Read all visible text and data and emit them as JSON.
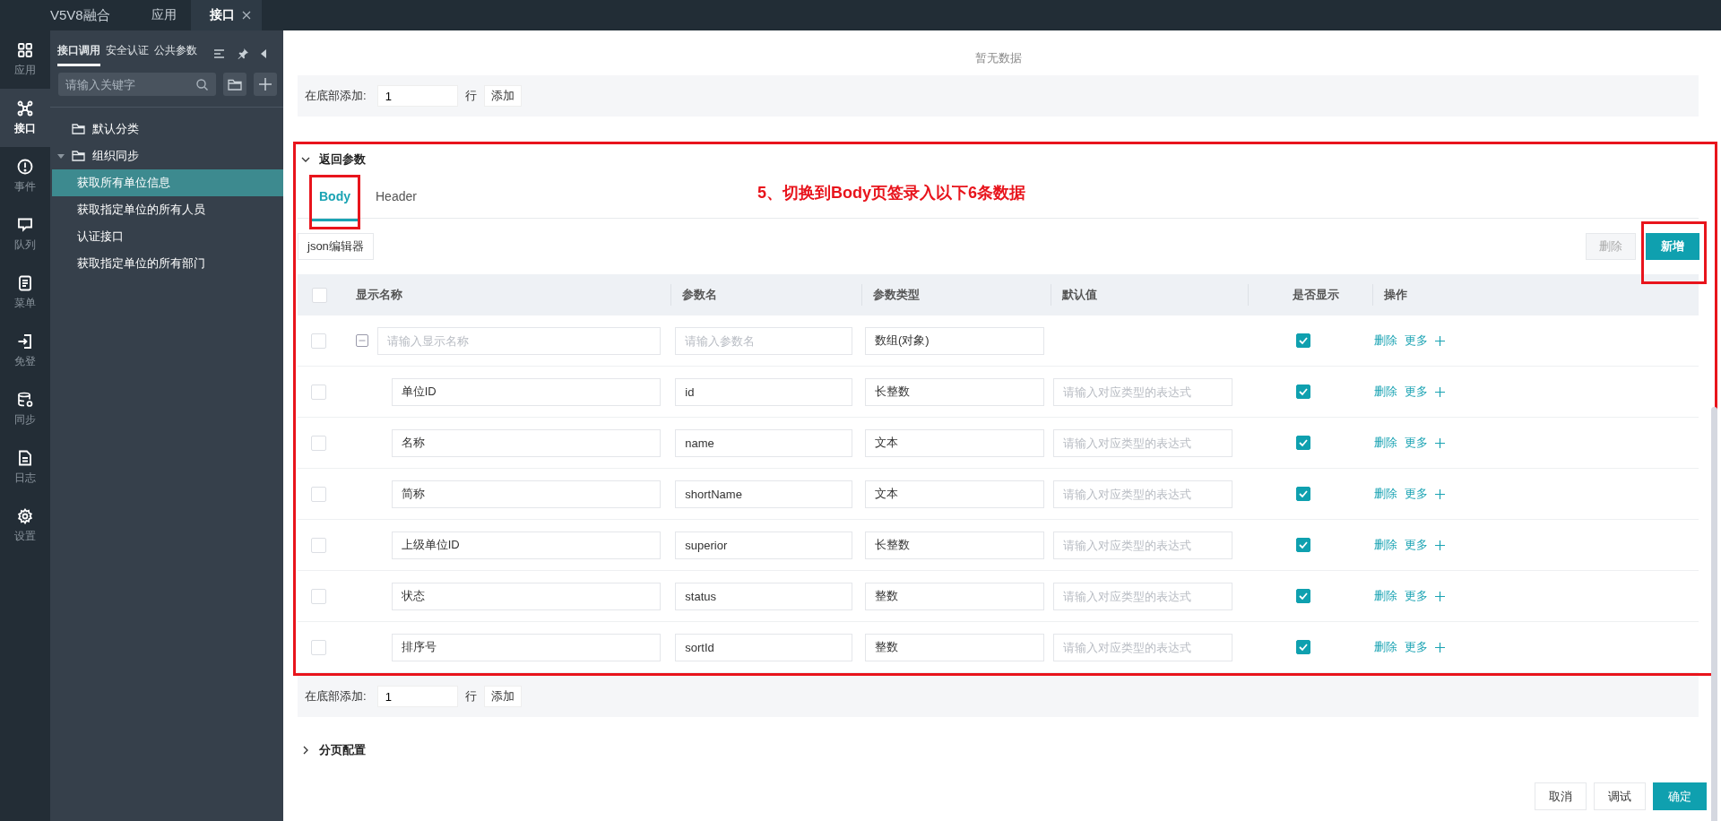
{
  "topbar": {
    "app_title": "V5V8融合",
    "tabs": [
      {
        "label": "应用",
        "selected": false,
        "closable": false
      },
      {
        "label": "接口",
        "selected": true,
        "closable": true
      }
    ]
  },
  "rail": [
    {
      "label": "应用",
      "kind": "grid",
      "selected": false
    },
    {
      "label": "接口",
      "kind": "nodes",
      "selected": true
    },
    {
      "label": "事件",
      "kind": "alert",
      "selected": false
    },
    {
      "label": "队列",
      "kind": "chat",
      "selected": false
    },
    {
      "label": "菜单",
      "kind": "note",
      "selected": false
    },
    {
      "label": "免登",
      "kind": "login",
      "selected": false
    },
    {
      "label": "同步",
      "kind": "database",
      "selected": false
    },
    {
      "label": "日志",
      "kind": "file",
      "selected": false
    },
    {
      "label": "设置",
      "kind": "gear",
      "selected": false
    }
  ],
  "sidebar": {
    "tabs": [
      {
        "label": "接口调用",
        "selected": true
      },
      {
        "label": "安全认证",
        "selected": false
      },
      {
        "label": "公共参数",
        "selected": false
      }
    ],
    "search": {
      "placeholder": "请输入关键字"
    },
    "tree": [
      {
        "label": "默认分类",
        "expanded": false
      },
      {
        "label": "组织同步",
        "expanded": true,
        "children": [
          {
            "label": "获取所有单位信息",
            "selected": true
          },
          {
            "label": "获取指定单位的所有人员",
            "selected": false
          },
          {
            "label": "认证接口",
            "selected": false
          },
          {
            "label": "获取指定单位的所有部门",
            "selected": false
          }
        ]
      }
    ]
  },
  "main": {
    "empty_text": "暂无数据",
    "top_add_bar": {
      "label": "在底部添加:",
      "value": "1",
      "unit": "行",
      "button": "添加"
    },
    "section": {
      "title": "返回参数",
      "expanded": true,
      "highlighted": true,
      "annotation": "5、切换到Body页签录入以下6条数据",
      "tabs": [
        {
          "label": "Body",
          "selected": true,
          "highlighted": true
        },
        {
          "label": "Header",
          "selected": false,
          "highlighted": false
        }
      ],
      "json_button": "json编辑器",
      "delete_button": {
        "label": "删除",
        "disabled": true
      },
      "add_button": {
        "label": "新增",
        "highlighted": true
      },
      "table": {
        "columns": [
          "显示名称",
          "参数名",
          "参数类型",
          "默认值",
          "是否显示",
          "操作"
        ],
        "rows": [
          {
            "name_placeholder": "请输入显示名称",
            "param_placeholder": "请输入参数名",
            "type": "数组(对象)",
            "visible": true,
            "actions": [
              "删除",
              "更多"
            ],
            "expanded": true,
            "children": [
              {
                "name": "单位ID",
                "param": "id",
                "type": "长整数",
                "default_placeholder": "请输入对应类型的表达式",
                "visible": true,
                "actions": [
                  "删除",
                  "更多"
                ]
              },
              {
                "name": "名称",
                "param": "name",
                "type": "文本",
                "default_placeholder": "请输入对应类型的表达式",
                "visible": true,
                "actions": [
                  "删除",
                  "更多"
                ]
              },
              {
                "name": "简称",
                "param": "shortName",
                "type": "文本",
                "default_placeholder": "请输入对应类型的表达式",
                "visible": true,
                "actions": [
                  "删除",
                  "更多"
                ]
              },
              {
                "name": "上级单位ID",
                "param": "superior",
                "type": "长整数",
                "default_placeholder": "请输入对应类型的表达式",
                "visible": true,
                "actions": [
                  "删除",
                  "更多"
                ]
              },
              {
                "name": "状态",
                "param": "status",
                "type": "整数",
                "default_placeholder": "请输入对应类型的表达式",
                "visible": true,
                "actions": [
                  "删除",
                  "更多"
                ]
              },
              {
                "name": "排序号",
                "param": "sortId",
                "type": "整数",
                "default_placeholder": "请输入对应类型的表达式",
                "visible": true,
                "actions": [
                  "删除",
                  "更多"
                ]
              }
            ]
          }
        ]
      }
    },
    "bottom_add_bar": {
      "label": "在底部添加:",
      "value": "1",
      "unit": "行",
      "button": "添加"
    },
    "paging_section": {
      "title": "分页配置",
      "expanded": false
    },
    "footer_buttons": [
      {
        "label": "取消",
        "kind": "plain"
      },
      {
        "label": "调试",
        "kind": "plain"
      },
      {
        "label": "确定",
        "kind": "primary"
      }
    ]
  }
}
